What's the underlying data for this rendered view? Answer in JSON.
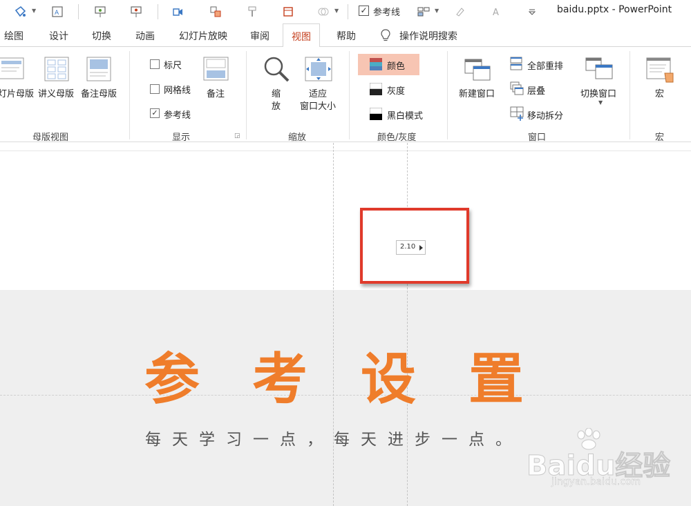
{
  "window": {
    "title": "baidu.pptx  -  PowerPoint"
  },
  "quick_access": {
    "guides_checked": true,
    "guides_label": "参考线"
  },
  "tabs": [
    {
      "label": "绘图"
    },
    {
      "label": "设计"
    },
    {
      "label": "切换"
    },
    {
      "label": "动画"
    },
    {
      "label": "幻灯片放映"
    },
    {
      "label": "审阅"
    },
    {
      "label": "视图",
      "active": true
    },
    {
      "label": "帮助"
    },
    {
      "label": "操作说明搜索"
    }
  ],
  "ribbon": {
    "master_views": {
      "group_label": "母版视图",
      "buttons": [
        "灯片母版",
        "讲义母版",
        "备注母版"
      ]
    },
    "show": {
      "group_label": "显示",
      "ruler": {
        "label": "标尺",
        "checked": false
      },
      "gridlines": {
        "label": "网格线",
        "checked": false
      },
      "guides": {
        "label": "参考线",
        "checked": true
      },
      "notes": "备注"
    },
    "zoom": {
      "group_label": "缩放",
      "zoom_line1": "缩",
      "zoom_line2": "放",
      "fit_line1": "适应",
      "fit_line2": "窗口大小"
    },
    "color_grayscale": {
      "group_label": "颜色/灰度",
      "color": "颜色",
      "grayscale": "灰度",
      "bw": "黑白模式"
    },
    "window": {
      "group_label": "窗口",
      "new_window": "新建窗口",
      "arrange_all": "全部重排",
      "cascade": "层叠",
      "move_split": "移动拆分",
      "switch_windows": "切换窗口"
    },
    "macros": {
      "group_label": "宏",
      "macros": "宏"
    }
  },
  "slide": {
    "guide_tooltip": "2.10",
    "headline_chars": [
      "参",
      "考",
      "设",
      "置"
    ],
    "subtitle": "每天学习一点，每天进步一点。",
    "watermark": "Baidu经验",
    "watermark_url": "jingyan.baidu.com"
  },
  "colors": {
    "accent_tab": "#c43e1c",
    "headline": "#ef7d2b",
    "highlight_box": "#e03a2b",
    "color_button_bg": "#f7c5b3"
  }
}
